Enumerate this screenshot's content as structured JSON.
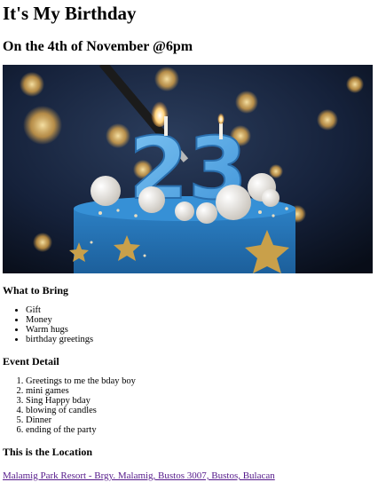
{
  "header": {
    "title": "It's My Birthday",
    "subtitle": "On the 4th of November @6pm"
  },
  "hero": {
    "number_topper": "23",
    "colors": {
      "cake": "#2a7fc4",
      "topper": "#5aaee8",
      "star": "#c9a04a",
      "background": "#0d1a2e"
    }
  },
  "bring": {
    "heading": "What to Bring",
    "items": [
      "Gift",
      "Money",
      "Warm hugs",
      "birthday greetings"
    ]
  },
  "detail": {
    "heading": "Event Detail",
    "items": [
      "Greetings to me the bday boy",
      "mini games",
      "Sing Happy bday",
      "blowing of candles",
      "Dinner",
      "ending of the party"
    ]
  },
  "location": {
    "heading": "This is the Location",
    "link_text": "Malamig Park Resort - Brgy. Malamig, Bustos 3007, Bustos, Bulacan"
  }
}
